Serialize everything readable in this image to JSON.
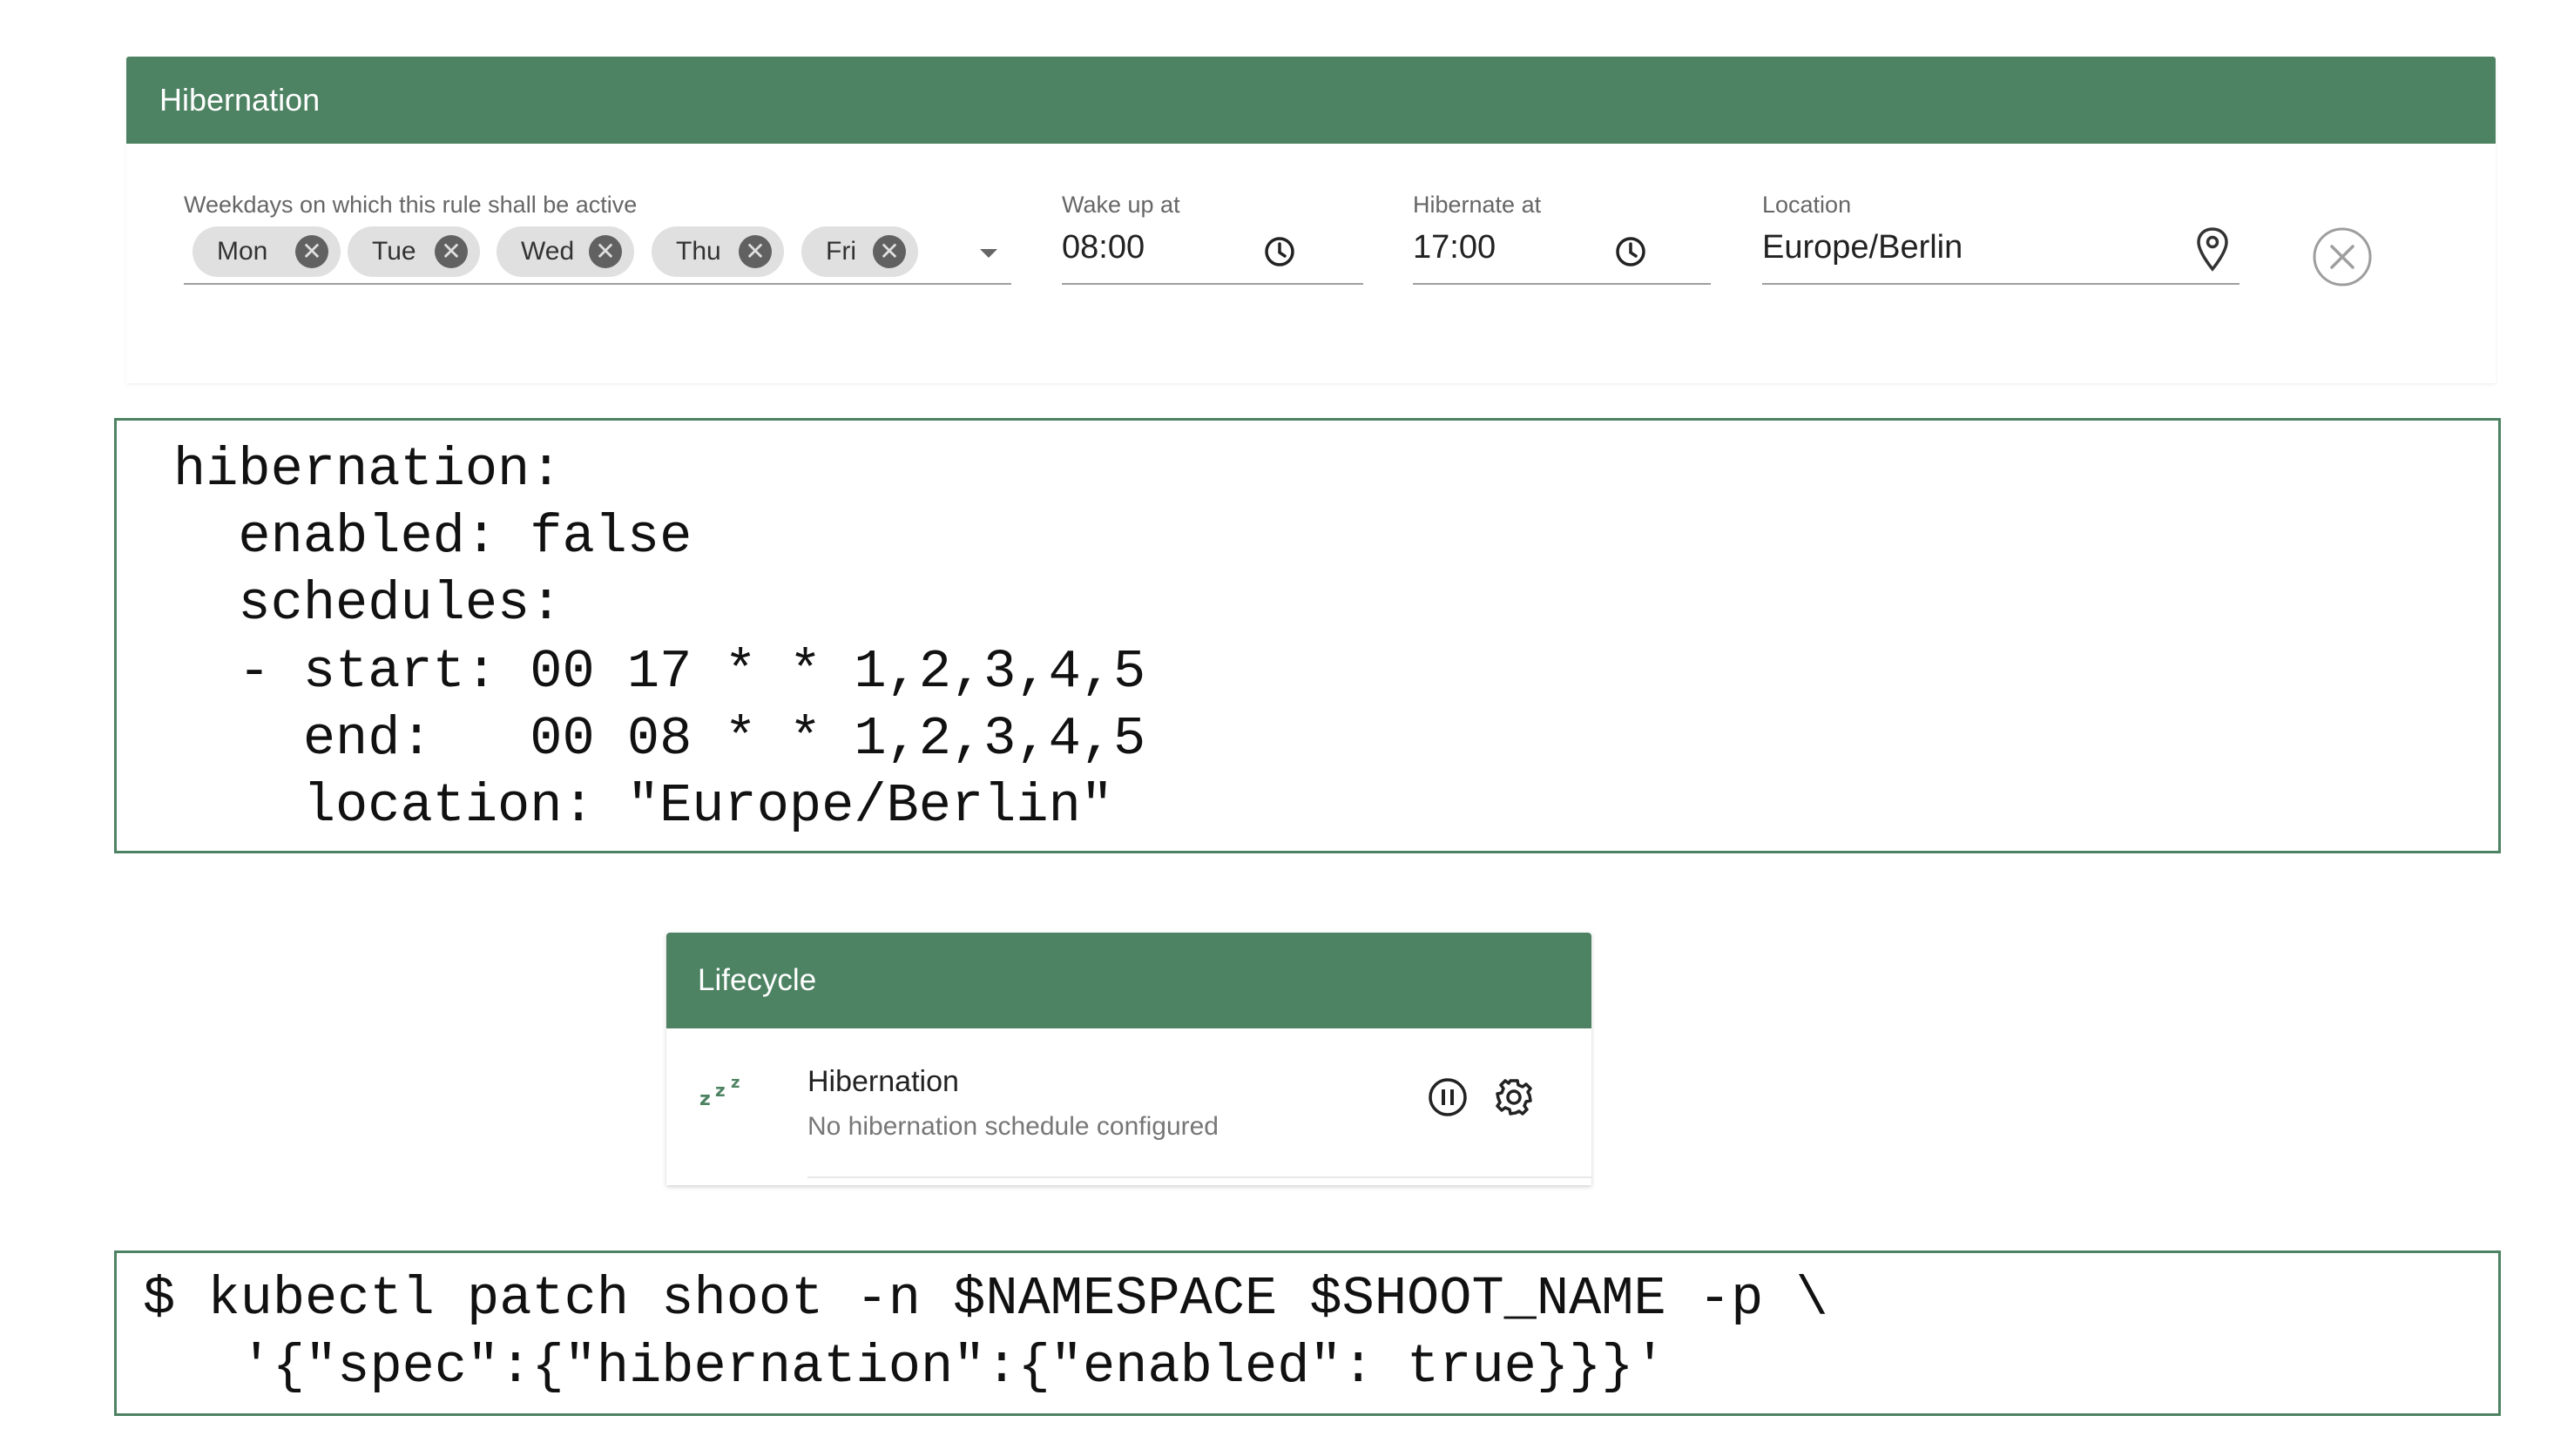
{
  "hibernation_panel": {
    "title": "Hibernation",
    "weekdays_label": "Weekdays on which this rule shall be active",
    "weekdays": [
      "Mon",
      "Tue",
      "Wed",
      "Thu",
      "Fri"
    ],
    "wake_label": "Wake up at",
    "wake_value": "08:00",
    "hibernate_label": "Hibernate at",
    "hibernate_value": "17:00",
    "location_label": "Location",
    "location_value": "Europe/Berlin",
    "accent_color": "#4d8262"
  },
  "yaml_code": {
    "lines": [
      "hibernation:",
      "  enabled: false",
      "  schedules:",
      "  - start: 00 17 * * 1,2,3,4,5",
      "    end:   00 08 * * 1,2,3,4,5",
      "    location: \"Europe/Berlin\""
    ]
  },
  "lifecycle_panel": {
    "title": "Lifecycle",
    "item_title": "Hibernation",
    "item_subtitle": "No hibernation schedule configured",
    "icon": "sleep-zzz-icon"
  },
  "cli_code": {
    "lines": [
      "$ kubectl patch shoot -n $NAMESPACE $SHOOT_NAME -p \\",
      "   '{\"spec\":{\"hibernation\":{\"enabled\": true}}}'"
    ]
  }
}
